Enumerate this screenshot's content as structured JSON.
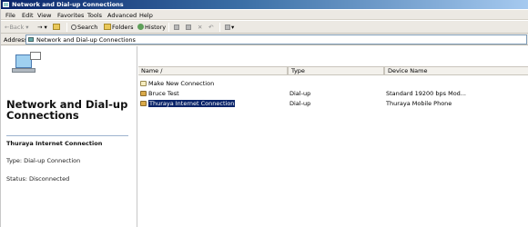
{
  "window": {
    "title": "Network and Dial-up Connections"
  },
  "menu": [
    "File",
    "Edit",
    "View",
    "Favorites",
    "Tools",
    "Advanced",
    "Help"
  ],
  "toolbar": {
    "back": "Back",
    "search": "Search",
    "folders": "Folders",
    "history": "History"
  },
  "address": {
    "label": "Address",
    "value": "Network and Dial-up Connections"
  },
  "left_pane": {
    "title": "Network and Dial-up Connections",
    "selected_name": "Thuraya Internet Connection",
    "type_line": "Type: Dial-up Connection",
    "status_line": "Status: Disconnected"
  },
  "columns": {
    "name": "Name",
    "type": "Type",
    "device": "Device Name"
  },
  "rows": [
    {
      "name": "Make New Connection",
      "type": "",
      "device": ""
    },
    {
      "name": "Bruce Test",
      "type": "Dial-up",
      "device": "Standard 19200 bps Mod..."
    },
    {
      "name": "Thuraya Internet Connection",
      "type": "Dial-up",
      "device": "Thuraya Mobile Phone"
    }
  ]
}
